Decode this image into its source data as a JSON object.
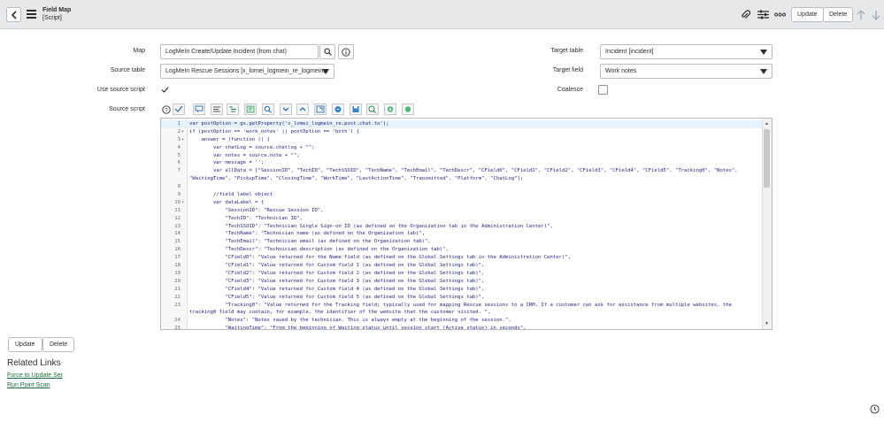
{
  "header": {
    "title": "Field Map",
    "subtitle": "[Script]",
    "update_label": "Update",
    "delete_label": "Delete"
  },
  "form": {
    "map_label": "Map",
    "map_value": "LogMeIn Create/Update Incident (from chat)",
    "source_table_label": "Source table",
    "source_table_value": "LogMeIn Rescue Sessions [x_lomei_logmein_re_logmein...",
    "use_source_script_label": "Use source script",
    "use_source_script_checked": true,
    "source_script_label": "Source script",
    "target_table_label": "Target table",
    "target_table_value": "Incident [incident]",
    "target_field_label": "Target field",
    "target_field_value": "Work notes",
    "coalesce_label": "Coalesce",
    "coalesce_checked": false
  },
  "toolbar_icons": [
    "help-icon",
    "syntax-check-icon",
    "comment-icon",
    "uncomment-icon",
    "format-code-icon",
    "toggle-highlighting-icon",
    "replace-icon",
    "search-icon",
    "find-next-icon",
    "find-prev-icon",
    "open-fullscreen-icon",
    "script-debugger-icon",
    "save-icon",
    "show-shortcuts-icon",
    "script-assist-icon"
  ],
  "code": [
    {
      "n": "1",
      "fold": "",
      "text": "var postOption = gs.getProperty('x_lomei_logmein_re.post.chat.to');",
      "active": true
    },
    {
      "n": "2",
      "fold": "▾",
      "text": "if (postOption == 'work_notes' || postOption == 'both') {"
    },
    {
      "n": "3",
      "fold": "▾",
      "text": "    answer = (function () {"
    },
    {
      "n": "4",
      "fold": "",
      "text": "        var chatLog = source.chatlog + \"\";"
    },
    {
      "n": "5",
      "fold": "",
      "text": "        var notes = source.note + \"\";"
    },
    {
      "n": "6",
      "fold": "",
      "text": "        var message = '';"
    },
    {
      "n": "7",
      "fold": "",
      "text": "        var allData = [\"SessionID\", \"TechID\", \"TechSSOID\", \"TechName\", \"TechEmail\", \"TechDescr\", \"CField0\", \"CField1\", \"CField2\", \"CField3\", \"CField4\", \"CField5\", \"Tracking0\", \"Notes\", \"WaitingTime\", \"PickupTime\", \"ClosingTime\", \"WorkTime\", \"LastActionTime\", \"Transmitted\", \"Platform\", \"ChatLog\"];",
      "wrap": true
    },
    {
      "n": "8",
      "fold": "",
      "text": ""
    },
    {
      "n": "9",
      "fold": "",
      "text": "        //field label object"
    },
    {
      "n": "10",
      "fold": "▾",
      "text": "        var dataLabel = {"
    },
    {
      "n": "11",
      "fold": "",
      "text": "            \"SessionID\": \"Rescue Session ID\","
    },
    {
      "n": "12",
      "fold": "",
      "text": "            \"TechID\": \"Technician ID\","
    },
    {
      "n": "13",
      "fold": "",
      "text": "            \"TechSSOID\": \"Technician Single Sign-on ID (as defined on the Organization tab in the Administration Center)\","
    },
    {
      "n": "14",
      "fold": "",
      "text": "            \"TechName\": \"Technician name (as defined on the Organization tab)\","
    },
    {
      "n": "15",
      "fold": "",
      "text": "            \"TechEmail\": \"Technician email (as defined on the Organization tab)\","
    },
    {
      "n": "16",
      "fold": "",
      "text": "            \"TechDescr\": \"Technician description (as defined on the Organization tab)\","
    },
    {
      "n": "17",
      "fold": "",
      "text": "            \"CField0\": \"Value returned for the Name field (as defined on the Global Settings tab in the Administration Center)\","
    },
    {
      "n": "18",
      "fold": "",
      "text": "            \"CField1\": \"Value returned for Custom field 1 (as defined on the Global Settings tab)\","
    },
    {
      "n": "19",
      "fold": "",
      "text": "            \"CField2\": \"Value returned for Custom field 2 (as defined on the Global Settings tab)\","
    },
    {
      "n": "20",
      "fold": "",
      "text": "            \"CField3\": \"Value returned for Custom field 3 (as defined on the Global Settings tab)\","
    },
    {
      "n": "21",
      "fold": "",
      "text": "            \"CField4\": \"Value returned for Custom field 4 (as defined on the Global Settings tab)\","
    },
    {
      "n": "22",
      "fold": "",
      "text": "            \"CField5\": \"Value returned for Custom field 5 (as defined on the Global Settings tab)\","
    },
    {
      "n": "23",
      "fold": "",
      "text": "            \"Tracking0\": \"Value returned for the Tracking field; typically used for mapping Rescue sessions to a CRM. If a customer can ask for assistance from multiple websites, the tracking0 field may contain, for example, the identifier of the website that the customer visited. \",",
      "wrap": true
    },
    {
      "n": "24",
      "fold": "",
      "text": "            \"Notes\": \"Notes saved by the technician. This is always empty at the beginning of the session.\","
    },
    {
      "n": "25",
      "fold": "",
      "text": "            \"WaitingTime\": \"From the beginning of Waiting status until session start (Active status) in seconds\","
    }
  ],
  "buttons": {
    "update_label": "Update",
    "delete_label": "Delete"
  },
  "related": {
    "title": "Related Links",
    "links": [
      "Force to Update Set",
      "Run Point Scan"
    ]
  },
  "colors": {
    "header_bg": "#e6e8ea",
    "link": "#1b6b3a",
    "active_line": "#e8f2fb"
  }
}
